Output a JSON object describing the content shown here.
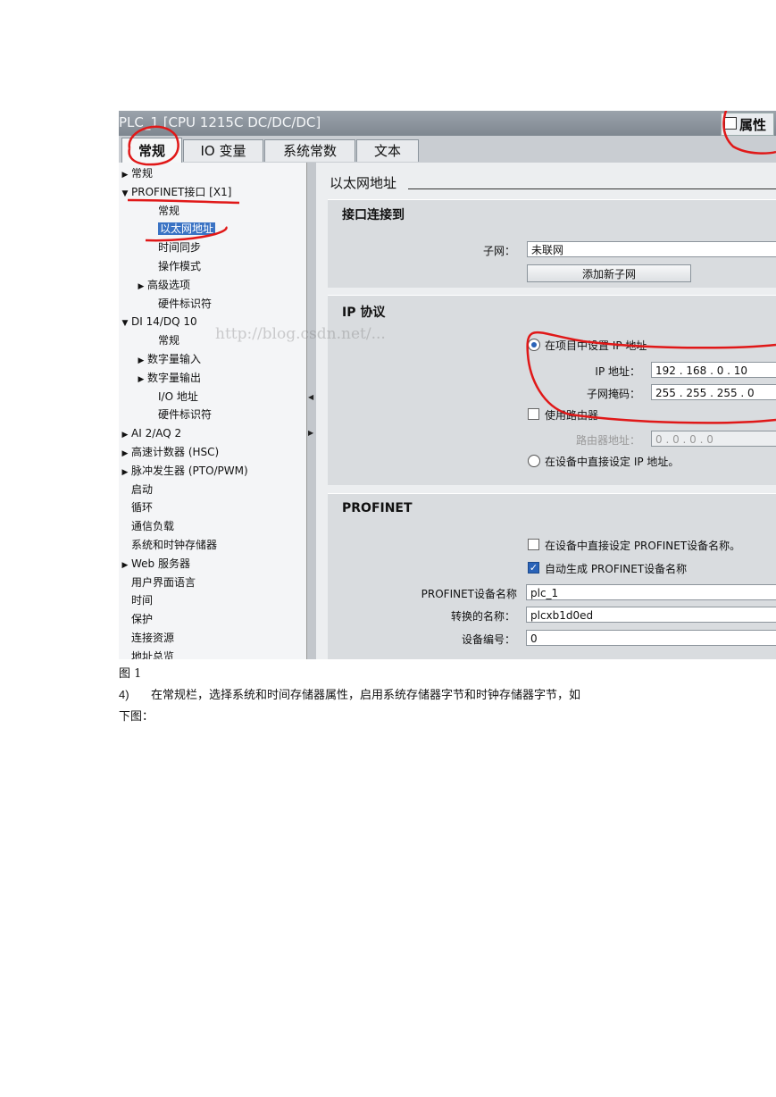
{
  "window": {
    "title": "PLC_1 [CPU 1215C DC/DC/DC]",
    "properties_label": "属性"
  },
  "tabs": [
    "常规",
    "IO 变量",
    "系统常数",
    "文本"
  ],
  "tree": [
    {
      "label": "常规",
      "arrow": "▶"
    },
    {
      "label": "PROFINET接口 [X1]",
      "arrow": "▼"
    },
    {
      "label": "常规",
      "arrow": ""
    },
    {
      "label": "以太网地址",
      "arrow": "",
      "selected": true
    },
    {
      "label": "时间同步",
      "arrow": ""
    },
    {
      "label": "操作模式",
      "arrow": ""
    },
    {
      "label": "高级选项",
      "arrow": "▶"
    },
    {
      "label": "硬件标识符",
      "arrow": ""
    },
    {
      "label": "DI 14/DQ 10",
      "arrow": "▼"
    },
    {
      "label": "常规",
      "arrow": ""
    },
    {
      "label": "数字量输入",
      "arrow": "▶"
    },
    {
      "label": "数字量输出",
      "arrow": "▶"
    },
    {
      "label": "I/O 地址",
      "arrow": ""
    },
    {
      "label": "硬件标识符",
      "arrow": ""
    },
    {
      "label": "AI 2/AQ 2",
      "arrow": "▶"
    },
    {
      "label": "高速计数器 (HSC)",
      "arrow": "▶"
    },
    {
      "label": "脉冲发生器 (PTO/PWM)",
      "arrow": "▶"
    },
    {
      "label": "启动",
      "arrow": ""
    },
    {
      "label": "循环",
      "arrow": ""
    },
    {
      "label": "通信负载",
      "arrow": ""
    },
    {
      "label": "系统和时钟存储器",
      "arrow": ""
    },
    {
      "label": "Web 服务器",
      "arrow": "▶"
    },
    {
      "label": "用户界面语言",
      "arrow": ""
    },
    {
      "label": "时间",
      "arrow": ""
    },
    {
      "label": "保护",
      "arrow": ""
    },
    {
      "label": "连接资源",
      "arrow": ""
    },
    {
      "label": "地址总览",
      "arrow": ""
    }
  ],
  "main": {
    "header": "以太网地址",
    "interface": {
      "title": "接口连接到",
      "subnet_label": "子网：",
      "subnet_value": "未联网",
      "add_subnet": "添加新子网"
    },
    "ip": {
      "title": "IP 协议",
      "set_in_project": "在项目中设置 IP 地址",
      "ip_label": "IP 地址：",
      "ip_value": "192 . 168 . 0    . 10",
      "mask_label": "子网掩码：",
      "mask_value": "255 . 255 . 255 . 0",
      "use_router": "使用路由器",
      "router_label": "路由器地址：",
      "router_value": "0    . 0    . 0    . 0",
      "set_on_device": "在设备中直接设定 IP 地址。"
    },
    "profinet": {
      "title": "PROFINET",
      "set_name_on_device": "在设备中直接设定 PROFINET设备名称。",
      "auto_generate": "自动生成 PROFINET设备名称",
      "device_name_label": "PROFINET设备名称",
      "device_name_value": "plc_1",
      "converted_label": "转换的名称：",
      "converted_value": "plcxb1d0ed",
      "device_number_label": "设备编号：",
      "device_number_value": "0"
    },
    "watermark": "http://blog.csdn.net/..."
  },
  "caption": "图 1",
  "step": {
    "number": "4)",
    "text_line1": "在常规栏，选择系统和时间存储器属性，启用系统存储器字节和时钟存储器字节，如",
    "text_line2": "下图："
  }
}
